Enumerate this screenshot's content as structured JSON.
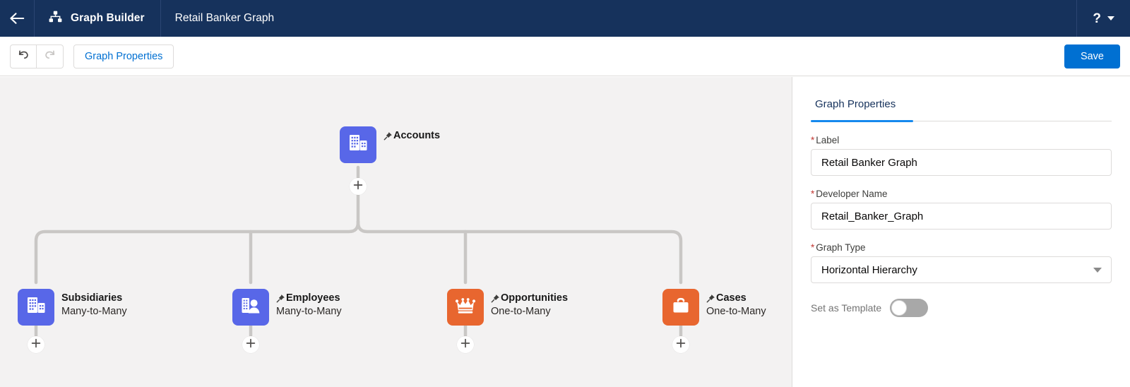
{
  "topnav": {
    "back_icon": "arrow-left-icon",
    "app_icon": "hierarchy-icon",
    "app_label": "Graph Builder",
    "record_label": "Retail Banker Graph",
    "help_icon": "question-mark-icon",
    "help_caret_icon": "chevron-down-icon"
  },
  "toolbar": {
    "undo_icon": "undo-icon",
    "redo_icon": "redo-icon",
    "graph_properties_label": "Graph Properties",
    "save_label": "Save"
  },
  "canvas": {
    "root": {
      "title": "Accounts",
      "pinned": true,
      "icon": "building-icon",
      "color": "#5867e8",
      "relationship": ""
    },
    "children": [
      {
        "title": "Subsidiaries",
        "relationship": "Many-to-Many",
        "pinned": false,
        "icon": "building-icon",
        "color": "#5867e8"
      },
      {
        "title": "Employees",
        "relationship": "Many-to-Many",
        "pinned": true,
        "icon": "building-person-icon",
        "color": "#5867e8"
      },
      {
        "title": "Opportunities",
        "relationship": "One-to-Many",
        "pinned": true,
        "icon": "crown-icon",
        "color": "#e8662f"
      },
      {
        "title": "Cases",
        "relationship": "One-to-Many",
        "pinned": true,
        "icon": "briefcase-icon",
        "color": "#e8662f"
      }
    ],
    "add_icon": "plus-icon"
  },
  "panel": {
    "tab_label": "Graph Properties",
    "fields": [
      {
        "label": "Label",
        "required": true,
        "value": "Retail Banker Graph",
        "type": "text"
      },
      {
        "label": "Developer Name",
        "required": true,
        "value": "Retail_Banker_Graph",
        "type": "text"
      },
      {
        "label": "Graph Type",
        "required": true,
        "value": "Horizontal Hierarchy",
        "type": "select"
      }
    ],
    "toggle": {
      "label": "Set as Template",
      "on": false
    }
  },
  "colors": {
    "header_navy": "#16325C",
    "accent_blue": "#0070d2",
    "tab_underline": "#1589ee",
    "node_blue": "#5867e8",
    "node_orange": "#e8662f",
    "canvas_bg": "#f3f2f2",
    "required_red": "#c23934"
  }
}
